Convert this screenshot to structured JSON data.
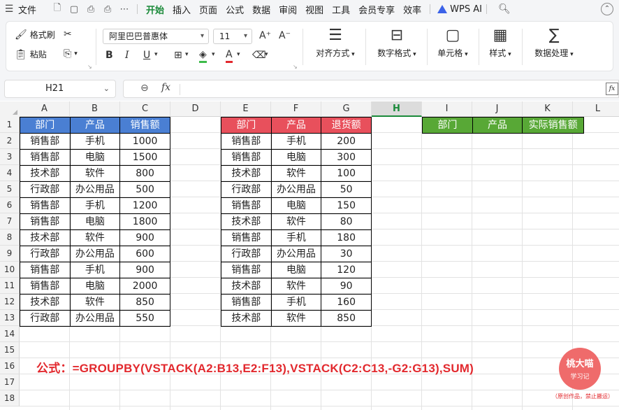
{
  "menubar": {
    "file_label": "文件",
    "tabs": [
      "开始",
      "插入",
      "页面",
      "公式",
      "数据",
      "审阅",
      "视图",
      "工具",
      "会员专享",
      "效率"
    ],
    "active_tab": "开始",
    "ai_label": "WPS AI"
  },
  "ribbon": {
    "format_painter": "格式刷",
    "paste": "粘贴",
    "font_name": "阿里巴巴普惠体",
    "font_size": "11",
    "bold": "B",
    "italic": "I",
    "underline": "U",
    "align": "对齐方式",
    "number_format": "数字格式",
    "cell": "单元格",
    "style": "样式",
    "data_process": "数据处理"
  },
  "formula_bar": {
    "name_box": "H21",
    "fx": "fx",
    "content": ""
  },
  "sheet": {
    "columns": [
      "A",
      "B",
      "C",
      "D",
      "E",
      "F",
      "G",
      "H",
      "I",
      "J",
      "K",
      "L"
    ],
    "selected_column": "H",
    "rows": [
      "1",
      "2",
      "3",
      "4",
      "5",
      "6",
      "7",
      "8",
      "9",
      "10",
      "11",
      "12",
      "13",
      "14",
      "15",
      "16",
      "17",
      "18"
    ],
    "sales_table": {
      "headers": [
        "部门",
        "产品",
        "销售额"
      ],
      "rows": [
        [
          "销售部",
          "手机",
          "1000"
        ],
        [
          "销售部",
          "电脑",
          "1500"
        ],
        [
          "技术部",
          "软件",
          "800"
        ],
        [
          "行政部",
          "办公用品",
          "500"
        ],
        [
          "销售部",
          "手机",
          "1200"
        ],
        [
          "销售部",
          "电脑",
          "1800"
        ],
        [
          "技术部",
          "软件",
          "900"
        ],
        [
          "行政部",
          "办公用品",
          "600"
        ],
        [
          "销售部",
          "手机",
          "900"
        ],
        [
          "销售部",
          "电脑",
          "2000"
        ],
        [
          "技术部",
          "软件",
          "850"
        ],
        [
          "行政部",
          "办公用品",
          "550"
        ]
      ]
    },
    "returns_table": {
      "headers": [
        "部门",
        "产品",
        "退货额"
      ],
      "rows": [
        [
          "销售部",
          "手机",
          "200"
        ],
        [
          "销售部",
          "电脑",
          "300"
        ],
        [
          "技术部",
          "软件",
          "100"
        ],
        [
          "行政部",
          "办公用品",
          "50"
        ],
        [
          "销售部",
          "电脑",
          "150"
        ],
        [
          "技术部",
          "软件",
          "80"
        ],
        [
          "销售部",
          "手机",
          "180"
        ],
        [
          "行政部",
          "办公用品",
          "30"
        ],
        [
          "销售部",
          "电脑",
          "120"
        ],
        [
          "技术部",
          "软件",
          "90"
        ],
        [
          "销售部",
          "手机",
          "160"
        ],
        [
          "技术部",
          "软件",
          "850"
        ]
      ]
    },
    "result_headers": [
      "部门",
      "产品",
      "实际销售额"
    ],
    "formula_note": "公式：=GROUPBY(VSTACK(A2:B13,E2:F13),VSTACK(C2:C13,-G2:G13),SUM)"
  },
  "watermark": {
    "name": "桃大喵",
    "sub": "学习记",
    "caption": "（原创作品，禁止搬运）"
  },
  "colors": {
    "blue_header": "#4a7fd3",
    "red_header": "#e8505c",
    "green_header": "#58a836",
    "accent": "#1b8a3a",
    "formula_note": "#e2292e"
  }
}
